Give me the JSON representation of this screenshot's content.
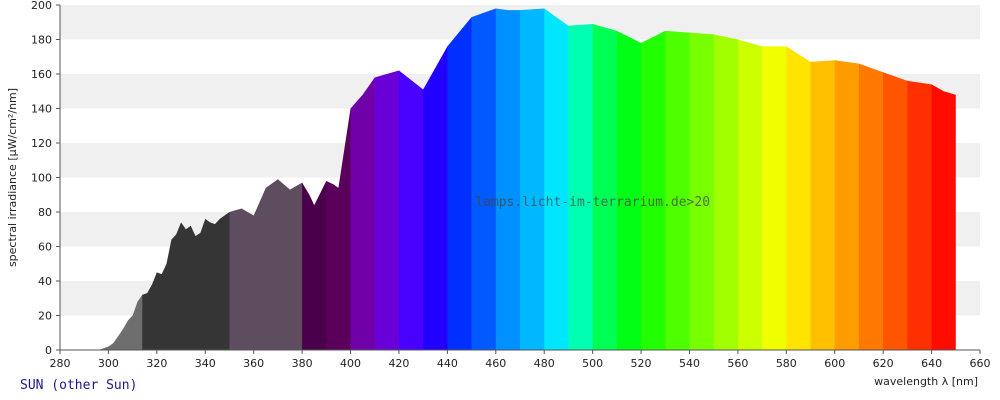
{
  "source_label": "SUN (other Sun)",
  "watermark": "lamps.licht-im-terrarium.de>20",
  "chart_data": {
    "type": "area",
    "title": "",
    "xlabel": "wavelength λ [nm]",
    "ylabel": "spectral irradiance [µW/cm²/nm]",
    "xlim": [
      280,
      660
    ],
    "ylim": [
      0,
      200
    ],
    "x_ticks": [
      280,
      300,
      320,
      340,
      360,
      380,
      400,
      420,
      440,
      460,
      480,
      500,
      520,
      540,
      560,
      580,
      600,
      620,
      640,
      660
    ],
    "y_ticks": [
      0,
      20,
      40,
      60,
      80,
      100,
      120,
      140,
      160,
      180,
      200
    ],
    "grid": "horizontal-bands",
    "band_colors": [
      "#f0f0f0",
      "#ffffff"
    ],
    "series": [
      {
        "x": [
          296,
          300,
          302,
          304,
          306,
          308,
          310,
          312,
          314,
          316,
          318,
          320,
          322,
          324,
          326,
          328,
          330,
          332,
          334,
          336,
          338,
          340,
          342,
          344,
          346,
          350,
          355,
          360,
          365,
          370,
          375,
          380,
          383,
          385,
          390,
          393,
          395,
          400,
          405,
          410,
          420,
          430,
          440,
          450,
          460,
          465,
          470,
          480,
          490,
          500,
          510,
          520,
          530,
          540,
          550,
          560,
          570,
          580,
          590,
          600,
          610,
          620,
          630,
          640,
          645,
          650
        ],
        "y": [
          0,
          2,
          4,
          8,
          12,
          17,
          20,
          28,
          32,
          33,
          38,
          45,
          44,
          50,
          64,
          67,
          74,
          70,
          72,
          66,
          68,
          76,
          74,
          73,
          76,
          80,
          82,
          78,
          94,
          99,
          93,
          97,
          90,
          84,
          98,
          96,
          94,
          140,
          148,
          158,
          162,
          151,
          176,
          193,
          198,
          197,
          197,
          198,
          188,
          189,
          185,
          178,
          185,
          184,
          183,
          180,
          176,
          176,
          167,
          168,
          166,
          161,
          156,
          154,
          150,
          148
        ]
      }
    ],
    "color_bands": [
      {
        "from": 296,
        "to": 314,
        "color": "#6e6e6e"
      },
      {
        "from": 314,
        "to": 350,
        "color": "#353535"
      },
      {
        "from": 350,
        "to": 380,
        "color": "#5e4d5e"
      },
      {
        "from": 380,
        "to": 390,
        "color": "#4a004a"
      },
      {
        "from": 390,
        "to": 400,
        "color": "#5a005a"
      },
      {
        "from": 400,
        "to": 410,
        "color": "#7000a8"
      },
      {
        "from": 410,
        "to": 420,
        "color": "#6a00d8"
      },
      {
        "from": 420,
        "to": 430,
        "color": "#4800ff"
      },
      {
        "from": 430,
        "to": 440,
        "color": "#2200ff"
      },
      {
        "from": 440,
        "to": 450,
        "color": "#0030ff"
      },
      {
        "from": 450,
        "to": 460,
        "color": "#005aff"
      },
      {
        "from": 460,
        "to": 470,
        "color": "#0090ff"
      },
      {
        "from": 470,
        "to": 480,
        "color": "#00b8ff"
      },
      {
        "from": 480,
        "to": 490,
        "color": "#00e6ff"
      },
      {
        "from": 490,
        "to": 500,
        "color": "#00ffb0"
      },
      {
        "from": 500,
        "to": 510,
        "color": "#00ff55"
      },
      {
        "from": 510,
        "to": 520,
        "color": "#00ff15"
      },
      {
        "from": 520,
        "to": 530,
        "color": "#22ff00"
      },
      {
        "from": 530,
        "to": 540,
        "color": "#4eff00"
      },
      {
        "from": 540,
        "to": 550,
        "color": "#78ff00"
      },
      {
        "from": 550,
        "to": 560,
        "color": "#a2ff00"
      },
      {
        "from": 560,
        "to": 570,
        "color": "#ccff00"
      },
      {
        "from": 570,
        "to": 580,
        "color": "#f0ff00"
      },
      {
        "from": 580,
        "to": 590,
        "color": "#ffe400"
      },
      {
        "from": 590,
        "to": 600,
        "color": "#ffc000"
      },
      {
        "from": 600,
        "to": 610,
        "color": "#ff9c00"
      },
      {
        "from": 610,
        "to": 620,
        "color": "#ff7800"
      },
      {
        "from": 620,
        "to": 630,
        "color": "#ff5400"
      },
      {
        "from": 630,
        "to": 640,
        "color": "#ff3000"
      },
      {
        "from": 640,
        "to": 650,
        "color": "#ff0c00"
      }
    ]
  }
}
